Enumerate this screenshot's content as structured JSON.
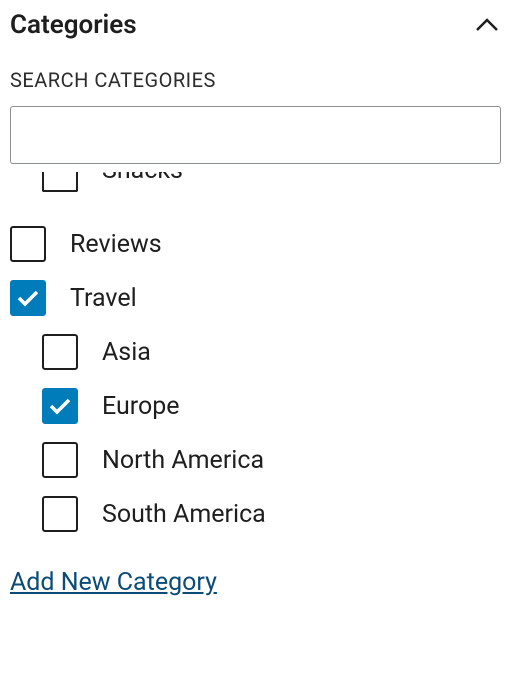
{
  "panel": {
    "title": "Categories"
  },
  "search": {
    "label": "SEARCH CATEGORIES",
    "value": ""
  },
  "categories": {
    "snacks": {
      "label": "Snacks",
      "checked": false
    },
    "reviews": {
      "label": "Reviews",
      "checked": false
    },
    "travel": {
      "label": "Travel",
      "checked": true
    },
    "asia": {
      "label": "Asia",
      "checked": false
    },
    "europe": {
      "label": "Europe",
      "checked": true
    },
    "north_america": {
      "label": "North America",
      "checked": false
    },
    "south_america": {
      "label": "South America",
      "checked": false
    }
  },
  "add_link": {
    "label": "Add New Category"
  }
}
